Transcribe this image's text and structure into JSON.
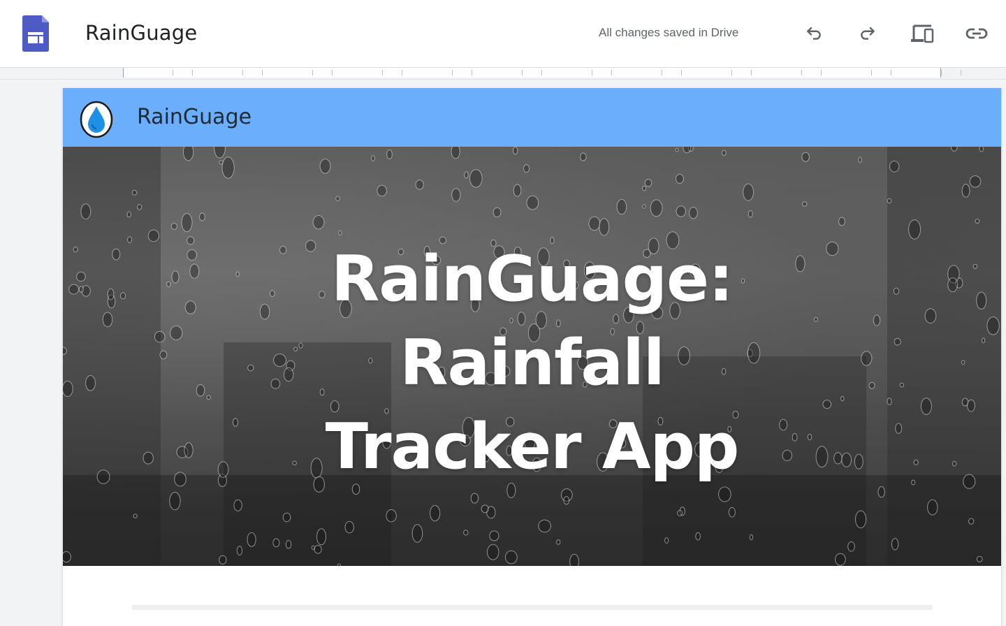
{
  "app": {
    "doc_title": "RainGuage",
    "save_status": "All changes saved in Drive",
    "icons": {
      "logo": "google-sites-icon",
      "undo": "undo-icon",
      "redo": "redo-icon",
      "preview": "devices-preview-icon",
      "link": "link-icon"
    },
    "colors": {
      "logo": "#4e5bc4",
      "toolbar_icon": "#5f6368"
    }
  },
  "site": {
    "header": {
      "name": "RainGuage",
      "logo_icon": "water-drop-icon",
      "background": "#6aaefc"
    },
    "hero": {
      "title_lines": [
        "RainGuage:",
        "Rainfall",
        "Tracker App"
      ],
      "background_description_icon": "rainy-window-image"
    }
  }
}
